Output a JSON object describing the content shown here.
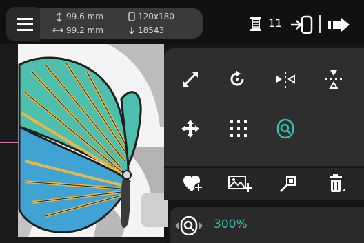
{
  "header": {
    "height_label": "99.6 mm",
    "width_label": "99.2 mm",
    "hoop_size": "120x180",
    "stitch_count": "18543",
    "thread_count": "11"
  },
  "icons": {
    "menu": "hamburger-menu-icon",
    "height": "height-arrow-icon",
    "width": "width-arrow-icon",
    "hoop": "hoop-icon",
    "stitches": "stitch-count-icon",
    "spool": "thread-spool-icon",
    "send_to_machine": "send-to-machine-icon",
    "forward": "forward-arrow-icon",
    "resize": "resize-diagonal-icon",
    "rotate": "rotate-icon",
    "mirror_h": "mirror-horizontal-icon",
    "mirror_v": "mirror-vertical-icon",
    "move": "move-cross-icon",
    "grid": "grid-dots-icon",
    "zoom_tool": "zoom-magnifier-icon",
    "favorite_add": "favorite-add-icon",
    "image_add": "image-add-icon",
    "pin": "pin-icon",
    "trash": "trash-icon",
    "zoom_indicator": "zoom-indicator-icon"
  },
  "zoom": {
    "value": "300%"
  },
  "colors": {
    "accent": "#33c0b3",
    "panel": "#2e2e2e",
    "background": "#161616",
    "marker": "#d07aa8"
  }
}
